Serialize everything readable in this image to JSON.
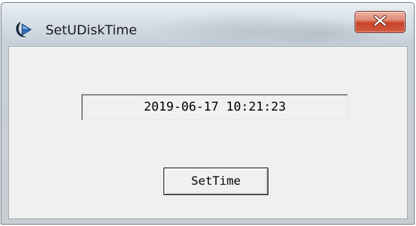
{
  "window": {
    "title": "SetUDiskTime",
    "app_icon": "app-icon",
    "close_icon": "close-icon"
  },
  "main": {
    "time_value": "2019-06-17 10:21:23",
    "set_button_label": "SetTime"
  },
  "colors": {
    "close_button": "#c9432b",
    "client_bg": "#f0f0f0"
  }
}
